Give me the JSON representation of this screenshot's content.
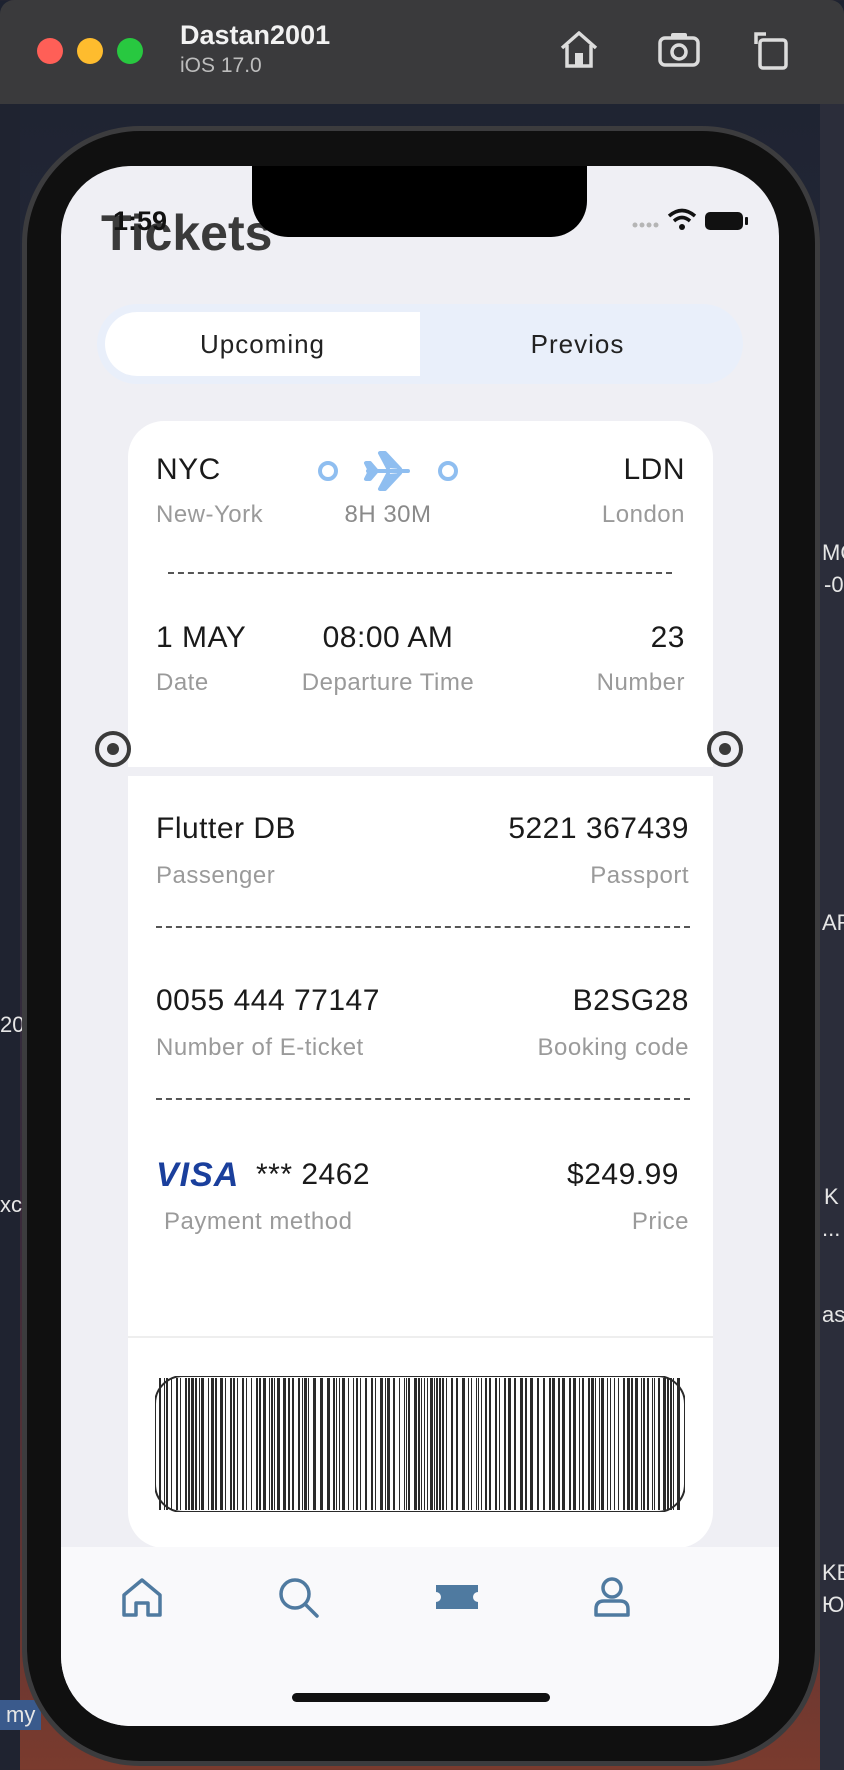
{
  "window": {
    "title": "Dastan2001",
    "subtitle": "iOS 17.0",
    "buttons": [
      "home-icon",
      "screenshot-icon",
      "rotate-icon"
    ]
  },
  "status_bar": {
    "time": "1:59"
  },
  "page": {
    "title": "Tickets"
  },
  "segments": {
    "upcoming": "Upcoming",
    "previous": "Previos"
  },
  "ticket": {
    "from_code": "NYC",
    "from_city": "New-York",
    "to_code": "LDN",
    "to_city": "London",
    "duration": "8H 30M",
    "date_value": "1 MAY",
    "date_label": "Date",
    "time_value": "08:00 AM",
    "time_label": "Departure Time",
    "number_value": "23",
    "number_label": "Number",
    "passenger_value": "Flutter DB",
    "passenger_label": "Passenger",
    "passport_value": "5221 367439",
    "passport_label": "Passport",
    "eticket_value": "0055 444 77147",
    "eticket_label": "Number of E-ticket",
    "booking_value": "B2SG28",
    "booking_label": "Booking code",
    "card_brand": "VISA",
    "card_number": "*** 2462",
    "payment_label": "Payment method",
    "price_value": "$249.99",
    "price_label": "Price"
  },
  "bottom_nav": [
    "home-icon",
    "search-icon",
    "ticket-icon",
    "profile-icon"
  ],
  "desktop_fragments": [
    "MO",
    "-0",
    "AR",
    "20",
    "xc",
    "K",
    "...",
    "as",
    "KE",
    "ЮI",
    "my"
  ],
  "colors": {
    "accent": "#4f7aa0",
    "plane": "#8fbef0"
  }
}
